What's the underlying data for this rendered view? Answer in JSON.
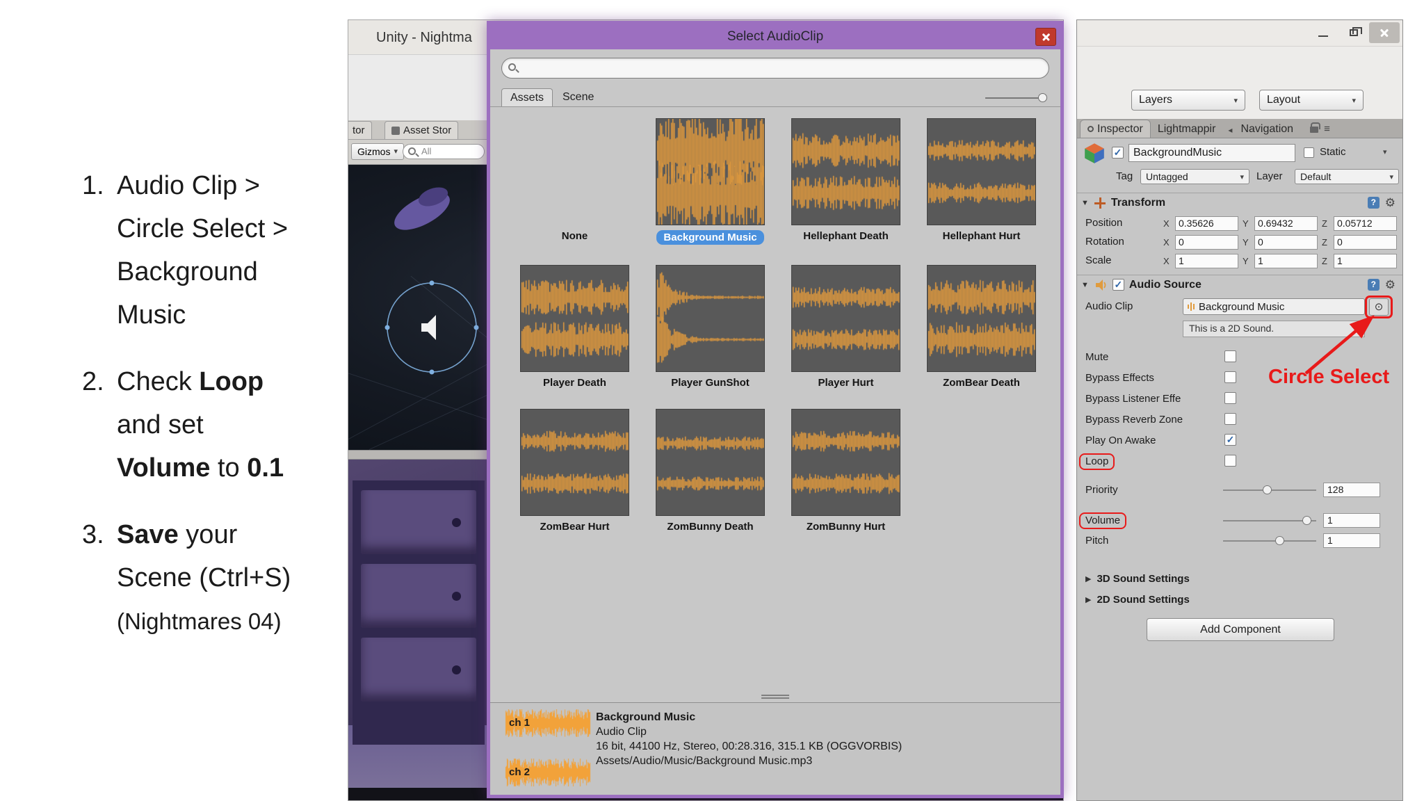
{
  "colors": {
    "dialog_purple": "#9c6fc0",
    "waveform_orange": "#f2a23a",
    "selection_blue": "#4a90dd",
    "annotation_red": "#e81a1a",
    "close_button_red": "#c0392b"
  },
  "icons": {
    "dropdown": "▾",
    "fold_open": "▼",
    "fold_closed": "▶",
    "gear": "⚙",
    "help": "?",
    "check": "✓",
    "circle_select": "⊙",
    "menu": "≡",
    "tab_scroll": "◂"
  },
  "slide": {
    "steps": [
      {
        "num": "1.",
        "lines": [
          [
            {
              "t": "Audio Clip >"
            }
          ],
          [
            {
              "t": "Circle Select >"
            }
          ],
          [
            {
              "t": "Background"
            }
          ],
          [
            {
              "t": "Music"
            }
          ]
        ]
      },
      {
        "num": "2.",
        "lines": [
          [
            {
              "t": "Check "
            },
            {
              "t": "Loop",
              "b": 1
            }
          ],
          [
            {
              "t": "and set"
            }
          ],
          [
            {
              "t": "Volume",
              "b": 1
            },
            {
              "t": " to "
            },
            {
              "t": "0.1",
              "b": 1
            }
          ]
        ]
      },
      {
        "num": "3.",
        "lines": [
          [
            {
              "t": "Save",
              "b": 1
            },
            {
              "t": " your"
            }
          ],
          [
            {
              "t": "Scene (Ctrl+S)"
            }
          ],
          [
            {
              "t": "(Nightmares 04)",
              "small": 1
            }
          ]
        ]
      }
    ]
  },
  "unity": {
    "title": "Unity - Nightma",
    "tab_fragment": "tor",
    "asset_store_tab": "Asset Stor",
    "gizmos_label": "Gizmos",
    "search_label": "All"
  },
  "dialog": {
    "title": "Select AudioClip",
    "search_value": "",
    "tabs": [
      "Assets",
      "Scene"
    ],
    "clips": [
      {
        "name": "None",
        "wave": null,
        "selected": false
      },
      {
        "name": "Background Music",
        "wave": "dense",
        "selected": true
      },
      {
        "name": "Hellephant Death",
        "wave": "med",
        "selected": false
      },
      {
        "name": "Hellephant Hurt",
        "wave": "low",
        "selected": false
      },
      {
        "name": "Player Death",
        "wave": "med",
        "selected": false
      },
      {
        "name": "Player GunShot",
        "wave": "attack",
        "selected": false
      },
      {
        "name": "Player Hurt",
        "wave": "low",
        "selected": false
      },
      {
        "name": "ZomBear Death",
        "wave": "med",
        "selected": false
      },
      {
        "name": "ZomBear Hurt",
        "wave": "low",
        "selected": false
      },
      {
        "name": "ZomBunny Death",
        "wave": "thin",
        "selected": false
      },
      {
        "name": "ZomBunny Hurt",
        "wave": "low",
        "selected": false
      }
    ],
    "preview": {
      "ch1": "ch 1",
      "ch2": "ch 2",
      "line1": "Background Music",
      "line2": "Audio Clip",
      "line3": "16 bit, 44100 Hz, Stereo, 00:28.316, 315.1 KB (OGGVORBIS)",
      "line4": "Assets/Audio/Music/Background Music.mp3"
    }
  },
  "inspector": {
    "layers_label": "Layers",
    "layout_label": "Layout",
    "tabs": {
      "inspector": "Inspector",
      "lightmapping": "Lightmappir",
      "navigation": "Navigation"
    },
    "header": {
      "name": "BackgroundMusic",
      "static_label": "Static",
      "tag_label": "Tag",
      "tag_value": "Untagged",
      "layer_label": "Layer",
      "layer_value": "Default"
    },
    "transform": {
      "title": "Transform",
      "axis_labels": [
        "X",
        "Y",
        "Z"
      ],
      "rows": [
        {
          "label": "Position",
          "x": "0.35626",
          "y": "0.69432",
          "z": "0.05712"
        },
        {
          "label": "Rotation",
          "x": "0",
          "y": "0",
          "z": "0"
        },
        {
          "label": "Scale",
          "x": "1",
          "y": "1",
          "z": "1"
        }
      ]
    },
    "audio_source": {
      "title": "Audio Source",
      "audio_clip_label": "Audio Clip",
      "audio_clip_value": "Background Music",
      "info_text": "This is a 2D Sound.",
      "toggles": [
        {
          "label": "Mute",
          "checked": false
        },
        {
          "label": "Bypass Effects",
          "checked": false
        },
        {
          "label": "Bypass Listener Effe",
          "checked": false
        },
        {
          "label": "Bypass Reverb Zone",
          "checked": false
        },
        {
          "label": "Play On Awake",
          "checked": true
        },
        {
          "label": "Loop",
          "checked": false,
          "highlight": true
        }
      ],
      "sliders": [
        {
          "label": "Priority",
          "value": "128",
          "pos": 0.47
        },
        {
          "label": "Volume",
          "value": "1",
          "pos": 0.94,
          "highlight": true
        },
        {
          "label": "Pitch",
          "value": "1",
          "pos": 0.62
        }
      ],
      "folds": [
        "3D Sound Settings",
        "2D Sound Settings"
      ]
    },
    "add_component_label": "Add Component"
  },
  "annotations": {
    "circle_select": "Circle Select"
  }
}
